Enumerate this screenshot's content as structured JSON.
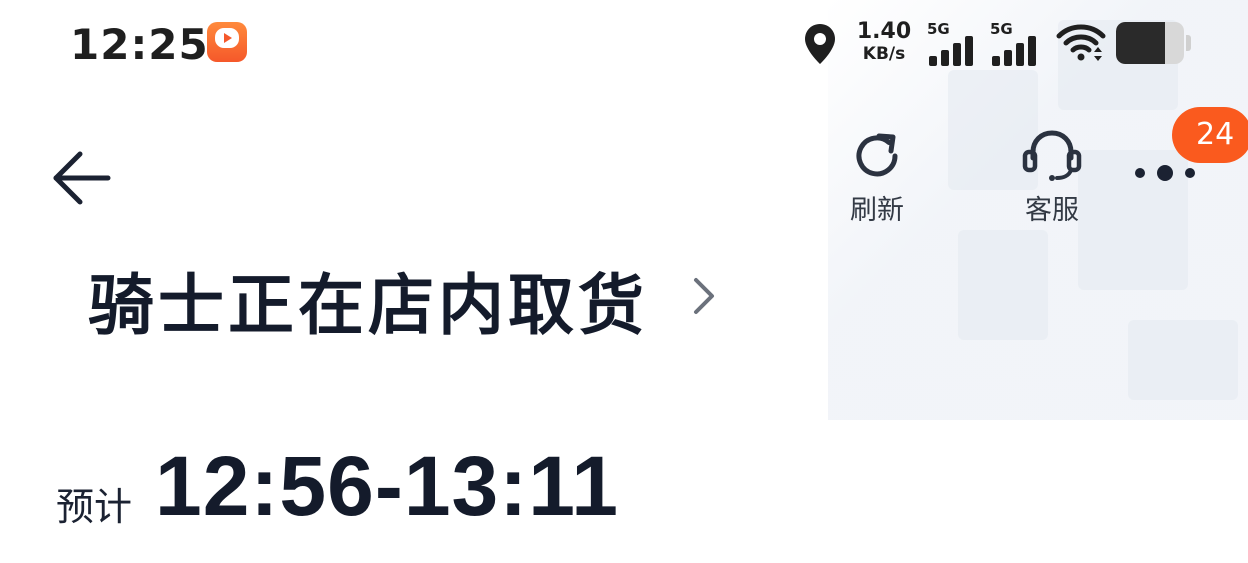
{
  "status_bar": {
    "time": "12:25",
    "app_icon": "video-app-icon",
    "app_badge_text": "",
    "net_speed_value": "1.40",
    "net_speed_unit": "KB/s",
    "sim1_label": "5G",
    "sim2_label": "5G",
    "icons": [
      "location-icon",
      "signal-icon",
      "wifi-icon",
      "battery-icon"
    ],
    "battery_level": 0.72
  },
  "nav": {
    "refresh_label": "刷新",
    "service_label": "客服",
    "unread_count": "24",
    "icons": [
      "back-arrow-icon",
      "refresh-icon",
      "headset-icon",
      "more-icon"
    ]
  },
  "order": {
    "status": "骑士正在店内取货",
    "eta_label": "预计",
    "eta_time": "12:56-13:11"
  },
  "colors": {
    "badge": "#fa5a1e",
    "text_primary": "#141b2b",
    "app_icon": "#f5582a"
  }
}
